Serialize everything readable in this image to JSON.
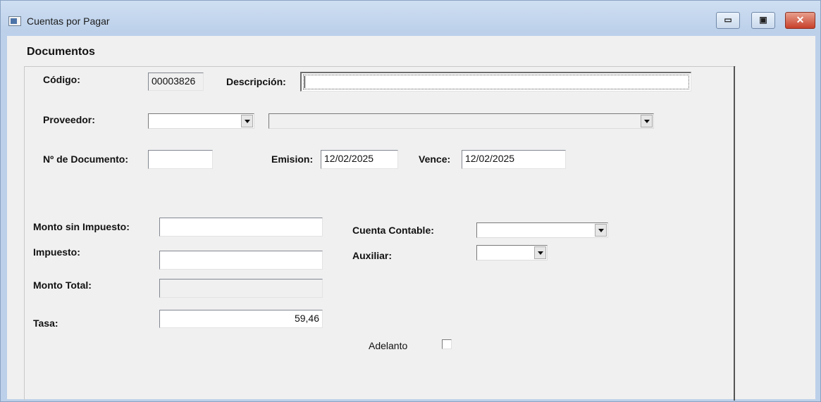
{
  "window": {
    "title": "Cuentas por Pagar",
    "buttons": {
      "minimize": "▭",
      "maximize": "▣",
      "close": "✕"
    }
  },
  "form": {
    "heading": "Documentos",
    "codigo": {
      "label": "Código:",
      "value": "00003826"
    },
    "descripcion": {
      "label": "Descripción:",
      "value": ""
    },
    "proveedor": {
      "label": "Proveedor:",
      "code_value": "",
      "name_value": ""
    },
    "documento": {
      "label": "Nº de Documento:",
      "value": ""
    },
    "emision": {
      "label": "Emision:",
      "value": "12/02/2025"
    },
    "vence": {
      "label": "Vence:",
      "value": "12/02/2025"
    },
    "monto_sin_impuesto": {
      "label": "Monto sin Impuesto:",
      "value": ""
    },
    "impuesto": {
      "label": "Impuesto:",
      "value": ""
    },
    "monto_total": {
      "label": "Monto Total:",
      "value": ""
    },
    "tasa": {
      "label": "Tasa:",
      "value": "59,46"
    },
    "cuenta_contable": {
      "label": "Cuenta Contable:",
      "value": ""
    },
    "auxiliar": {
      "label": "Auxiliar:",
      "value": ""
    },
    "adelanto": {
      "label": "Adelanto",
      "checked": false
    }
  }
}
